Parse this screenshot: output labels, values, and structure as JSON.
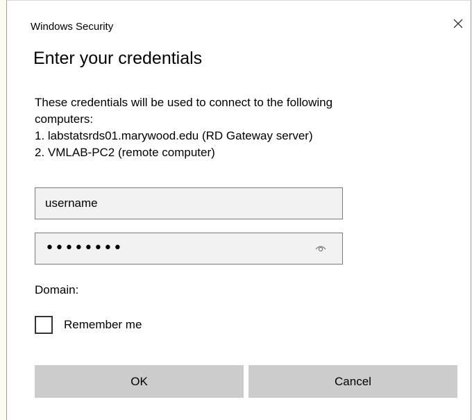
{
  "window": {
    "title": "Windows Security",
    "close_icon": "close-icon"
  },
  "dialog": {
    "heading": "Enter your credentials",
    "description_lines": [
      "These credentials will be used to connect to the following",
      "computers:",
      "1. labstatsrds01.marywood.edu (RD Gateway server)",
      "2. VMLAB-PC2 (remote computer)"
    ]
  },
  "form": {
    "username_value": "username",
    "password_masked": "••••••••",
    "reveal_icon": "eye-icon",
    "domain_label": "Domain:",
    "remember_label": "Remember me",
    "remember_checked": false
  },
  "buttons": {
    "ok_label": "OK",
    "cancel_label": "Cancel"
  },
  "colors": {
    "button_bg": "#cccccc",
    "field_bg": "#f2f2f2",
    "field_border": "#7a7a7a"
  }
}
